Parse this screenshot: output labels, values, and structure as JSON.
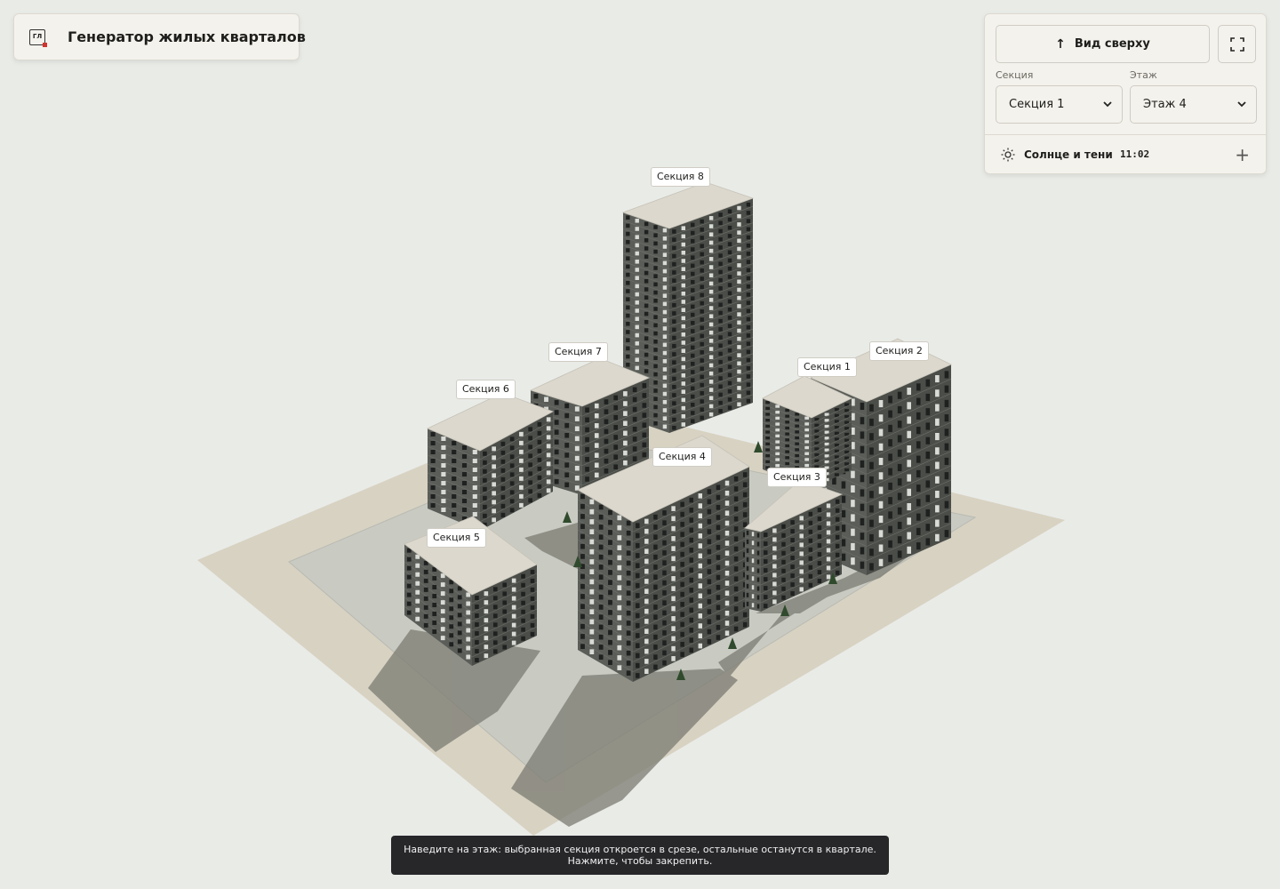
{
  "app": {
    "title": "Генератор жилых кварталов",
    "logo_text": "ГЛ"
  },
  "controls": {
    "top_view_label": "Вид сверху",
    "top_view_icon": "arrow-up-icon",
    "fullscreen_icon": "fullscreen-icon",
    "section_label": "Секция",
    "section_value": "Секция 1",
    "floor_label": "Этаж",
    "floor_value": "Этаж 4",
    "sun_label": "Солнце и тени",
    "sun_time": "11:02",
    "sun_icon": "sun-icon",
    "expand_icon": "plus-icon"
  },
  "sections": [
    {
      "id": "1",
      "label": "Секция 1",
      "floors": 12
    },
    {
      "id": "2",
      "label": "Секция 2",
      "floors": 12
    },
    {
      "id": "3",
      "label": "Секция 3",
      "floors": 9
    },
    {
      "id": "4",
      "label": "Секция 4",
      "floors": 16
    },
    {
      "id": "5",
      "label": "Секция 5",
      "floors": 8
    },
    {
      "id": "6",
      "label": "Секция 6",
      "floors": 9
    },
    {
      "id": "7",
      "label": "Секция 7",
      "floors": 9
    },
    {
      "id": "8",
      "label": "Секция 8",
      "floors": 25
    }
  ],
  "hint": {
    "line1": "Наведите на этаж: выбранная секция откроется в срезе, остальные останутся в квартале.",
    "line2": "Нажмите, чтобы закрепить."
  },
  "colors": {
    "background": "#e9ebe7",
    "ground": "#d8d2c2",
    "block_plot": "#c9cbc3",
    "shadow": "#7b7b72",
    "roof": "#dcd8cd",
    "facade_dark": "#4a4d48",
    "facade_light": "#5a5d58",
    "accent_red": "#d2322d"
  }
}
